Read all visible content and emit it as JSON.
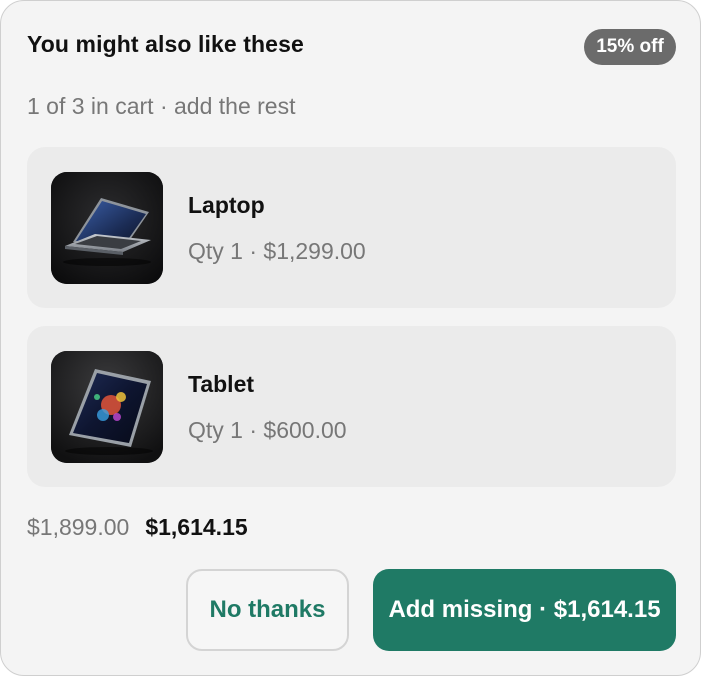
{
  "header": {
    "title": "You might also like these",
    "badge": "15% off",
    "subtitle": "1 of 3 in cart · add the rest"
  },
  "items": [
    {
      "name": "Laptop",
      "meta": "Qty 1 · $1,299.00",
      "image_icon": "laptop-image"
    },
    {
      "name": "Tablet",
      "meta": "Qty 1 · $600.00",
      "image_icon": "tablet-image"
    }
  ],
  "totals": {
    "original": "$1,899.00",
    "discounted": "$1,614.15"
  },
  "actions": {
    "decline_label": "No thanks",
    "accept_label": "Add missing · $1,614.15"
  },
  "colors": {
    "accent": "#1f7a65",
    "badge": "#6b6b6b",
    "card": "#f4f4f4",
    "item_bg": "#ebebeb"
  }
}
